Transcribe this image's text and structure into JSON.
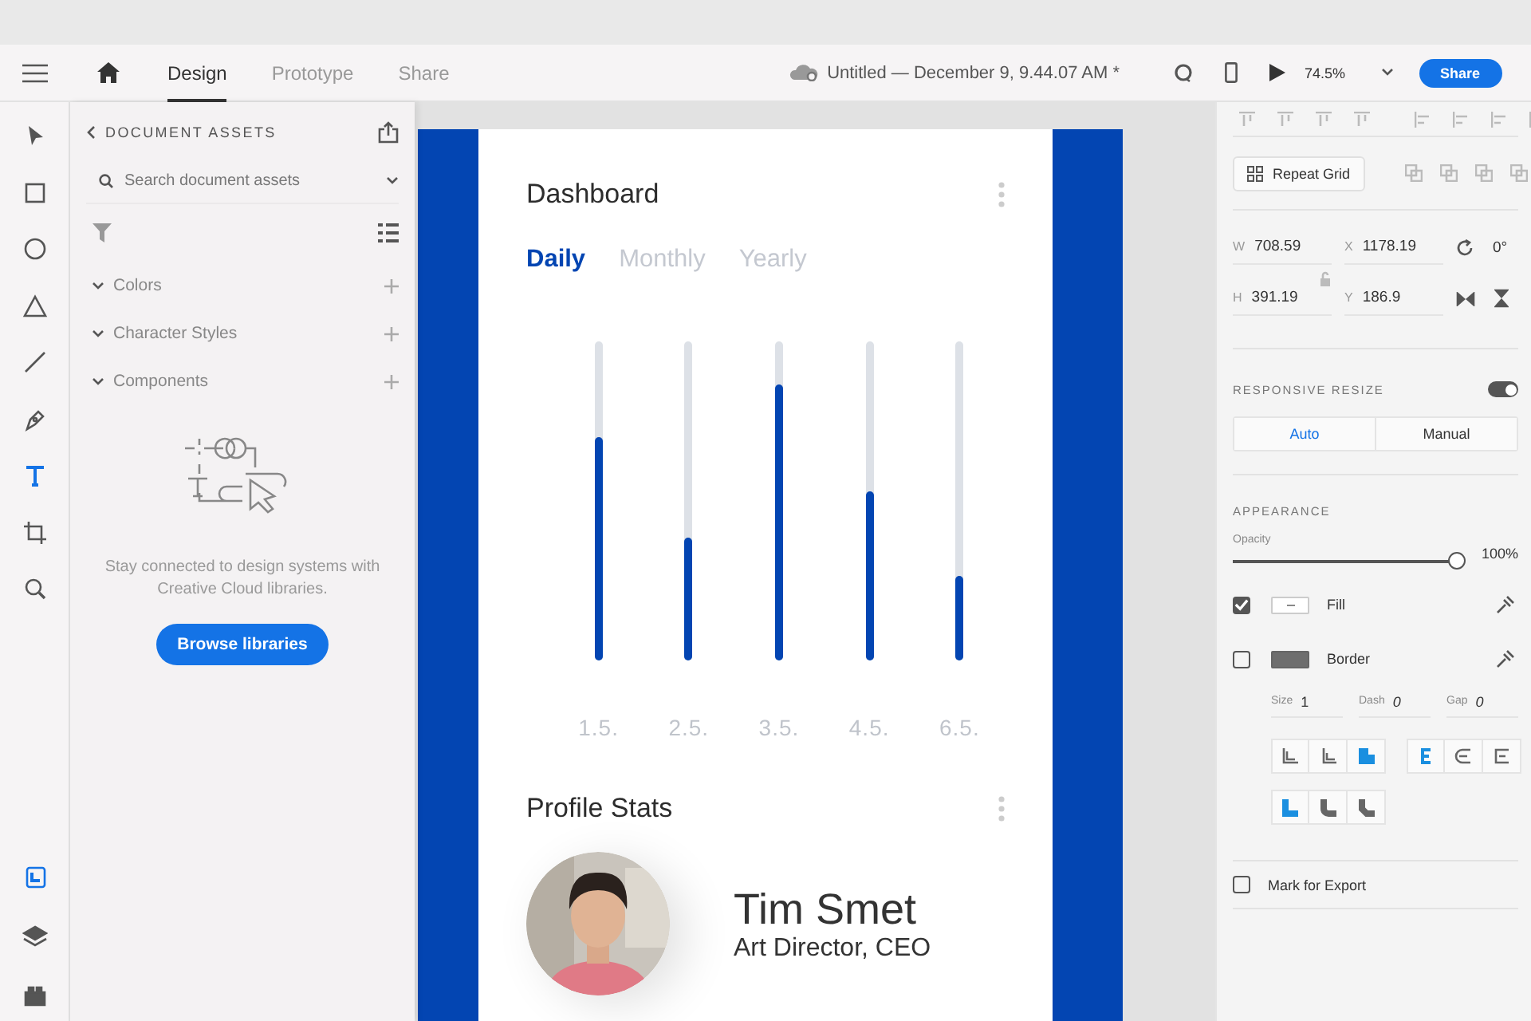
{
  "header": {
    "tabs": [
      {
        "label": "Design",
        "selected": true
      },
      {
        "label": "Prototype",
        "selected": false
      },
      {
        "label": "Share",
        "selected": false
      }
    ],
    "document_title": "Untitled — December 9, 9.44.07 AM *",
    "zoom": "74.5%",
    "share_button": "Share"
  },
  "tools": [
    {
      "selected": false
    },
    {
      "selected": false
    },
    {
      "selected": false
    },
    {
      "selected": false
    },
    {
      "selected": false
    },
    {
      "selected": false
    },
    {
      "selected": true
    },
    {
      "selected": false
    },
    {
      "selected": false
    }
  ],
  "panels": [
    {
      "selected": true
    },
    {
      "selected": false
    },
    {
      "selected": false
    }
  ],
  "assets": {
    "title": "DOCUMENT ASSETS",
    "search": {
      "placeholder": "Search document assets"
    },
    "sections": [
      {
        "label": "Colors"
      },
      {
        "label": "Character Styles"
      },
      {
        "label": "Components"
      }
    ],
    "empty_message": "Stay connected to design systems with Creative Cloud libraries.",
    "button": "Browse libraries"
  },
  "artboard": {
    "title": "Dashboard",
    "tabs": [
      {
        "label": "Daily",
        "selected": true
      },
      {
        "label": "Monthly",
        "selected": false
      },
      {
        "label": "Yearly",
        "selected": false
      }
    ],
    "bars": [
      {
        "label": "1.5.",
        "level": 0.7
      },
      {
        "label": "2.5.",
        "level": 0.385
      },
      {
        "label": "3.5.",
        "level": 0.865
      },
      {
        "label": "4.5.",
        "level": 0.53
      },
      {
        "label": "6.5.",
        "level": 0.265
      }
    ],
    "profile_title": "Profile Stats",
    "profile": {
      "name": "Tim Smet",
      "role": "Art Director, CEO"
    }
  },
  "inspector": {
    "repeat_grid": "Repeat Grid",
    "fields": [
      {
        "label": "W",
        "value": "708.59"
      },
      {
        "label": "X",
        "value": "1178.19"
      },
      {
        "label": "H",
        "value": "391.19"
      },
      {
        "label": "Y",
        "value": "186.9"
      }
    ],
    "rotation": "0°",
    "responsive_resize": {
      "label": "RESPONSIVE RESIZE",
      "on": true,
      "modes": [
        {
          "label": "Auto",
          "selected": true
        },
        {
          "label": "Manual",
          "selected": false
        }
      ]
    },
    "appearance": {
      "label": "APPEARANCE",
      "opacity": {
        "label": "Opacity",
        "level": 1,
        "reading": "100%"
      },
      "fill": {
        "label": "Fill",
        "checked": true
      },
      "border": {
        "label": "Border",
        "checked": false
      },
      "stroke": [
        {
          "label": "Size",
          "value": "1"
        },
        {
          "label": "Dash",
          "value": "0"
        },
        {
          "label": "Gap",
          "value": "0"
        }
      ],
      "stroke_position": [
        {
          "selected": false
        },
        {
          "selected": false
        },
        {
          "selected": true
        }
      ],
      "stroke_join": [
        {
          "selected": true
        },
        {
          "selected": false
        },
        {
          "selected": false
        }
      ],
      "corners": [
        {
          "selected": true
        },
        {
          "selected": false
        },
        {
          "selected": false
        }
      ]
    },
    "export": {
      "label": "Mark for Export",
      "checked": false
    }
  }
}
